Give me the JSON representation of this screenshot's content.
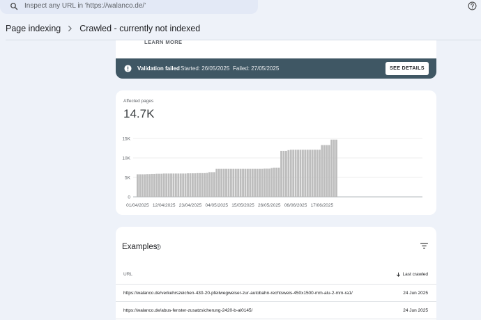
{
  "search": {
    "placeholder": "Inspect any URL in 'https://walanco.de/'"
  },
  "breadcrumb": {
    "parent": "Page indexing",
    "current": "Crawled - currently not indexed"
  },
  "learn_more": "LEARN MORE",
  "validation": {
    "status": "Validation failed",
    "started": "Started: 26/05/2025",
    "failed": "Failed: 27/05/2025",
    "button": "SEE DETAILS"
  },
  "affected": {
    "label": "Affected pages",
    "value": "14.7K"
  },
  "colors": {
    "validation_bar": "#3f5764",
    "chart_bar": "#bdbdbd",
    "background": "#eef2f9"
  },
  "chart_data": {
    "type": "bar",
    "ylim": [
      0,
      15000
    ],
    "y_ticks": [
      "0",
      "5K",
      "10K",
      "15K"
    ],
    "x_tick_labels": [
      "01/04/2025",
      "12/04/2025",
      "23/04/2025",
      "04/05/2025",
      "15/05/2025",
      "26/05/2025",
      "06/06/2025",
      "17/06/2025"
    ],
    "categories": [
      "01/04",
      "02/04",
      "03/04",
      "04/04",
      "05/04",
      "06/04",
      "07/04",
      "08/04",
      "09/04",
      "10/04",
      "11/04",
      "12/04",
      "13/04",
      "14/04",
      "15/04",
      "16/04",
      "17/04",
      "18/04",
      "19/04",
      "20/04",
      "21/04",
      "22/04",
      "23/04",
      "24/04",
      "25/04",
      "26/04",
      "27/04",
      "28/04",
      "29/04",
      "30/04",
      "01/05",
      "02/05",
      "03/05",
      "04/05",
      "05/05",
      "06/05",
      "07/05",
      "08/05",
      "09/05",
      "10/05",
      "11/05",
      "12/05",
      "13/05",
      "14/05",
      "15/05",
      "16/05",
      "17/05",
      "18/05",
      "19/05",
      "20/05",
      "21/05",
      "22/05",
      "23/05",
      "24/05",
      "25/05",
      "26/05",
      "27/05",
      "28/05",
      "29/05",
      "30/05",
      "31/05",
      "01/06",
      "02/06",
      "03/06",
      "04/06",
      "05/06",
      "06/06",
      "07/06",
      "08/06",
      "09/06",
      "10/06",
      "11/06",
      "12/06",
      "13/06",
      "14/06",
      "15/06",
      "16/06",
      "17/06",
      "18/06",
      "19/06",
      "20/06",
      "21/06",
      "22/06",
      "23/06"
    ],
    "values": [
      5800,
      5800,
      5800,
      5800,
      5850,
      5850,
      5900,
      5900,
      5950,
      5950,
      5950,
      6000,
      6000,
      6000,
      6000,
      6000,
      6000,
      6000,
      6000,
      6000,
      6000,
      6050,
      6050,
      6050,
      6050,
      6100,
      6100,
      6100,
      6100,
      6150,
      6350,
      6350,
      6350,
      7200,
      7200,
      7200,
      7200,
      7200,
      7200,
      7200,
      7200,
      7200,
      7200,
      7200,
      7200,
      7200,
      7200,
      7200,
      7200,
      7200,
      7200,
      7200,
      7200,
      7250,
      7250,
      7250,
      7400,
      7500,
      7500,
      7500,
      11800,
      11800,
      11800,
      12000,
      12100,
      12100,
      12100,
      12100,
      12100,
      12100,
      12100,
      12100,
      12100,
      12100,
      12100,
      12100,
      12100,
      13300,
      13300,
      13300,
      13300,
      14700,
      14700,
      14700
    ]
  },
  "examples": {
    "title": "Examples",
    "col_url": "URL",
    "col_crawled": "Last crawled",
    "rows": [
      {
        "url": "https://walanco.de/verkehrszeichen-430-20-pfeilwegweiser-zur-autobahn-rechtsweis-450x1500-mm-alu-2-mm-ra1/",
        "date": "24 Jun 2025"
      },
      {
        "url": "https://walanco.de/abus-fenster-zusatzsicherung-2420-b-al0145/",
        "date": "24 Jun 2025"
      }
    ]
  }
}
